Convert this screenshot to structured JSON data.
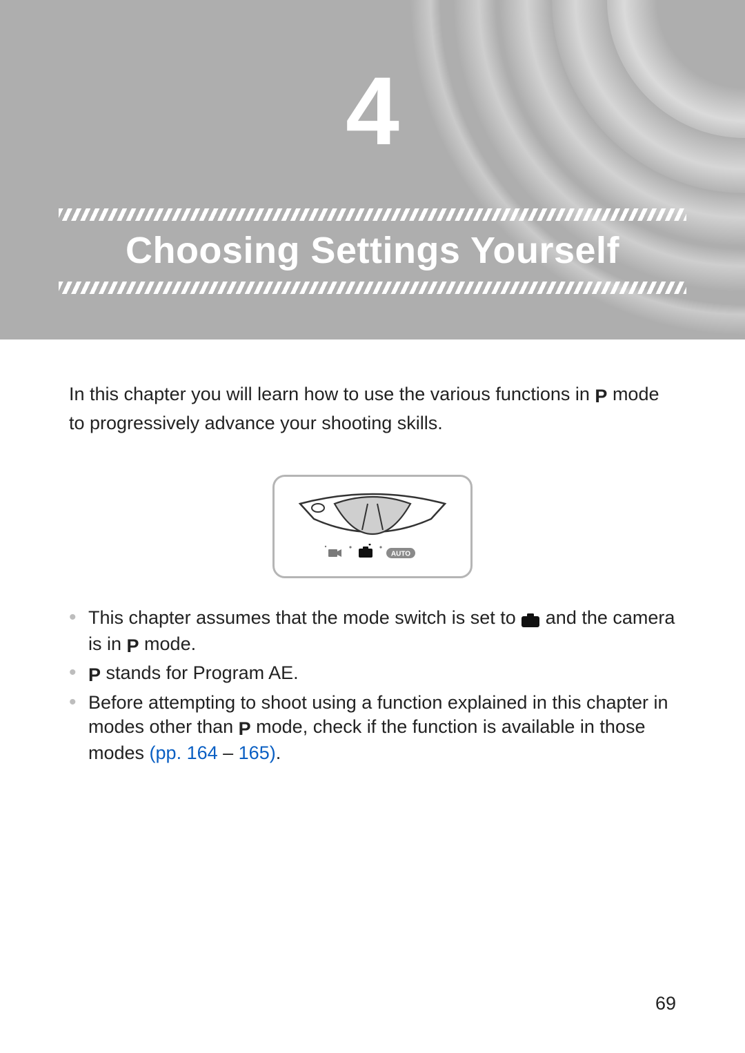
{
  "chapter": {
    "number": "4",
    "title": "Choosing Settings Yourself"
  },
  "intro": {
    "part1": "In this chapter you will learn how to use the various functions in ",
    "p_icon": "P",
    "part2": " mode to progressively advance your shooting skills."
  },
  "bullets": {
    "b1": {
      "part1": "This chapter assumes that the mode switch is set to ",
      "camera_icon": "camera-icon",
      "part2": " and the camera is in ",
      "p_icon": "P",
      "part3": " mode."
    },
    "b2": {
      "p_icon": "P",
      "text": " stands for Program AE."
    },
    "b3": {
      "part1": "Before attempting to shoot using a function explained in this chapter in modes other than ",
      "p_icon": "P",
      "part2": " mode, check if the function is available in those modes ",
      "ref1": "(pp. 164",
      "dash": " – ",
      "ref2": "165)",
      "period": "."
    }
  },
  "figure": {
    "auto_label": "AUTO"
  },
  "page_number": "69"
}
